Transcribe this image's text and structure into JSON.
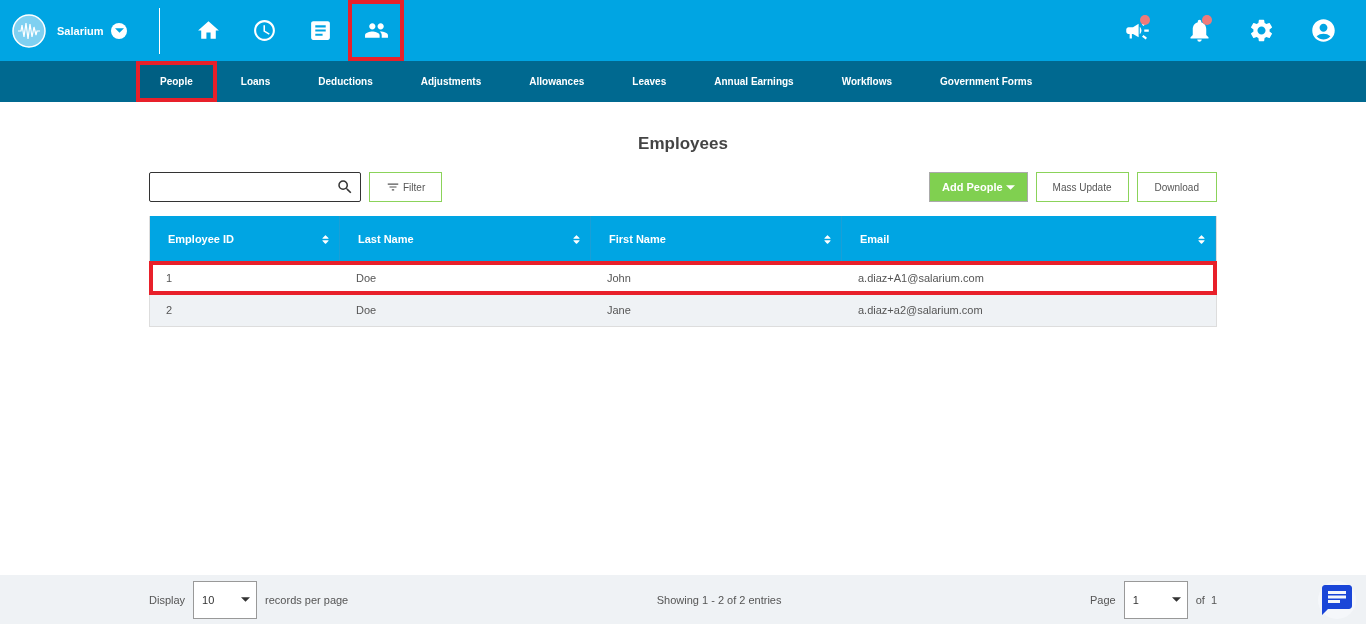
{
  "brand": {
    "name": "Salarium"
  },
  "nav_icons": [
    {
      "kind": "home",
      "annotated": false
    },
    {
      "kind": "clock",
      "annotated": false
    },
    {
      "kind": "document",
      "annotated": false
    },
    {
      "kind": "people",
      "annotated": true
    }
  ],
  "header_icons": [
    {
      "kind": "megaphone",
      "badge": true
    },
    {
      "kind": "bell",
      "badge": true
    },
    {
      "kind": "settings",
      "badge": false
    },
    {
      "kind": "account",
      "badge": false
    }
  ],
  "tabs": [
    {
      "label": "People",
      "selected": true,
      "annotated": true
    },
    {
      "label": "Loans",
      "selected": false,
      "annotated": false
    },
    {
      "label": "Deductions",
      "selected": false,
      "annotated": false
    },
    {
      "label": "Adjustments",
      "selected": false,
      "annotated": false
    },
    {
      "label": "Allowances",
      "selected": false,
      "annotated": false
    },
    {
      "label": "Leaves",
      "selected": false,
      "annotated": false
    },
    {
      "label": "Annual Earnings",
      "selected": false,
      "annotated": false
    },
    {
      "label": "Workflows",
      "selected": false,
      "annotated": false
    },
    {
      "label": "Government Forms",
      "selected": false,
      "annotated": false
    }
  ],
  "page_title": "Employees",
  "toolbar": {
    "filter": "Filter",
    "add": "Add People",
    "mass_update": "Mass Update",
    "download": "Download"
  },
  "table": {
    "columns": [
      "Employee ID",
      "Last Name",
      "First Name",
      "Email"
    ],
    "rows": [
      {
        "cells": [
          "1",
          "Doe",
          "John",
          "a.diaz+A1@salarium.com"
        ],
        "annotated": true
      },
      {
        "cells": [
          "2",
          "Doe",
          "Jane",
          "a.diaz+a2@salarium.com"
        ],
        "annotated": false
      }
    ]
  },
  "footer": {
    "display_label": "Display",
    "page_size": "10",
    "per_page_label": "records per page",
    "summary": "Showing 1 - 2 of 2 entries",
    "page_label": "Page",
    "page": "1",
    "of_label": "of",
    "page_count": "1"
  }
}
